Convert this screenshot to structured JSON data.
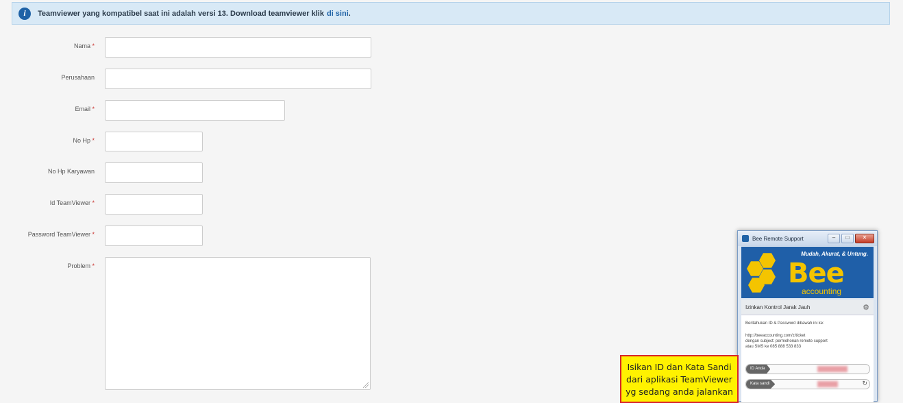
{
  "info": {
    "message": "Teamviewer yang kompatibel saat ini adalah versi 13. Download teamviewer klik",
    "link": "di sini",
    "suffix": "."
  },
  "form": {
    "required_mark": "*",
    "fields": {
      "nama": "Nama",
      "perusahaan": "Perusahaan",
      "email": "Email",
      "no_hp": "No Hp",
      "no_hp_karyawan": "No Hp Karyawan",
      "id_teamviewer": "Id TeamViewer",
      "password_teamviewer": "Password TeamViewer",
      "problem": "Problem"
    }
  },
  "tv": {
    "title": "Bee Remote Support",
    "tagline": "Mudah, Akurat, & Untung.",
    "logo": "Bee",
    "logo_sub": "accounting",
    "section_title": "Izinkan Kontrol Jarak Jauh",
    "instruction": "Beritahukan ID & Password dibawah ini ke:",
    "contact_1": "http://beeaccounting.com/z/ticket",
    "contact_2": "dengan subject: permohonan remote support",
    "contact_3": "atau SMS ke 085 888 533 833",
    "id_label": "ID Anda",
    "pass_label": "Kata sandi"
  },
  "callout": {
    "line1": "Isikan ID dan Kata Sandi",
    "line2": "dari aplikasi TeamViewer",
    "line3": "yg sedang anda jalankan"
  }
}
